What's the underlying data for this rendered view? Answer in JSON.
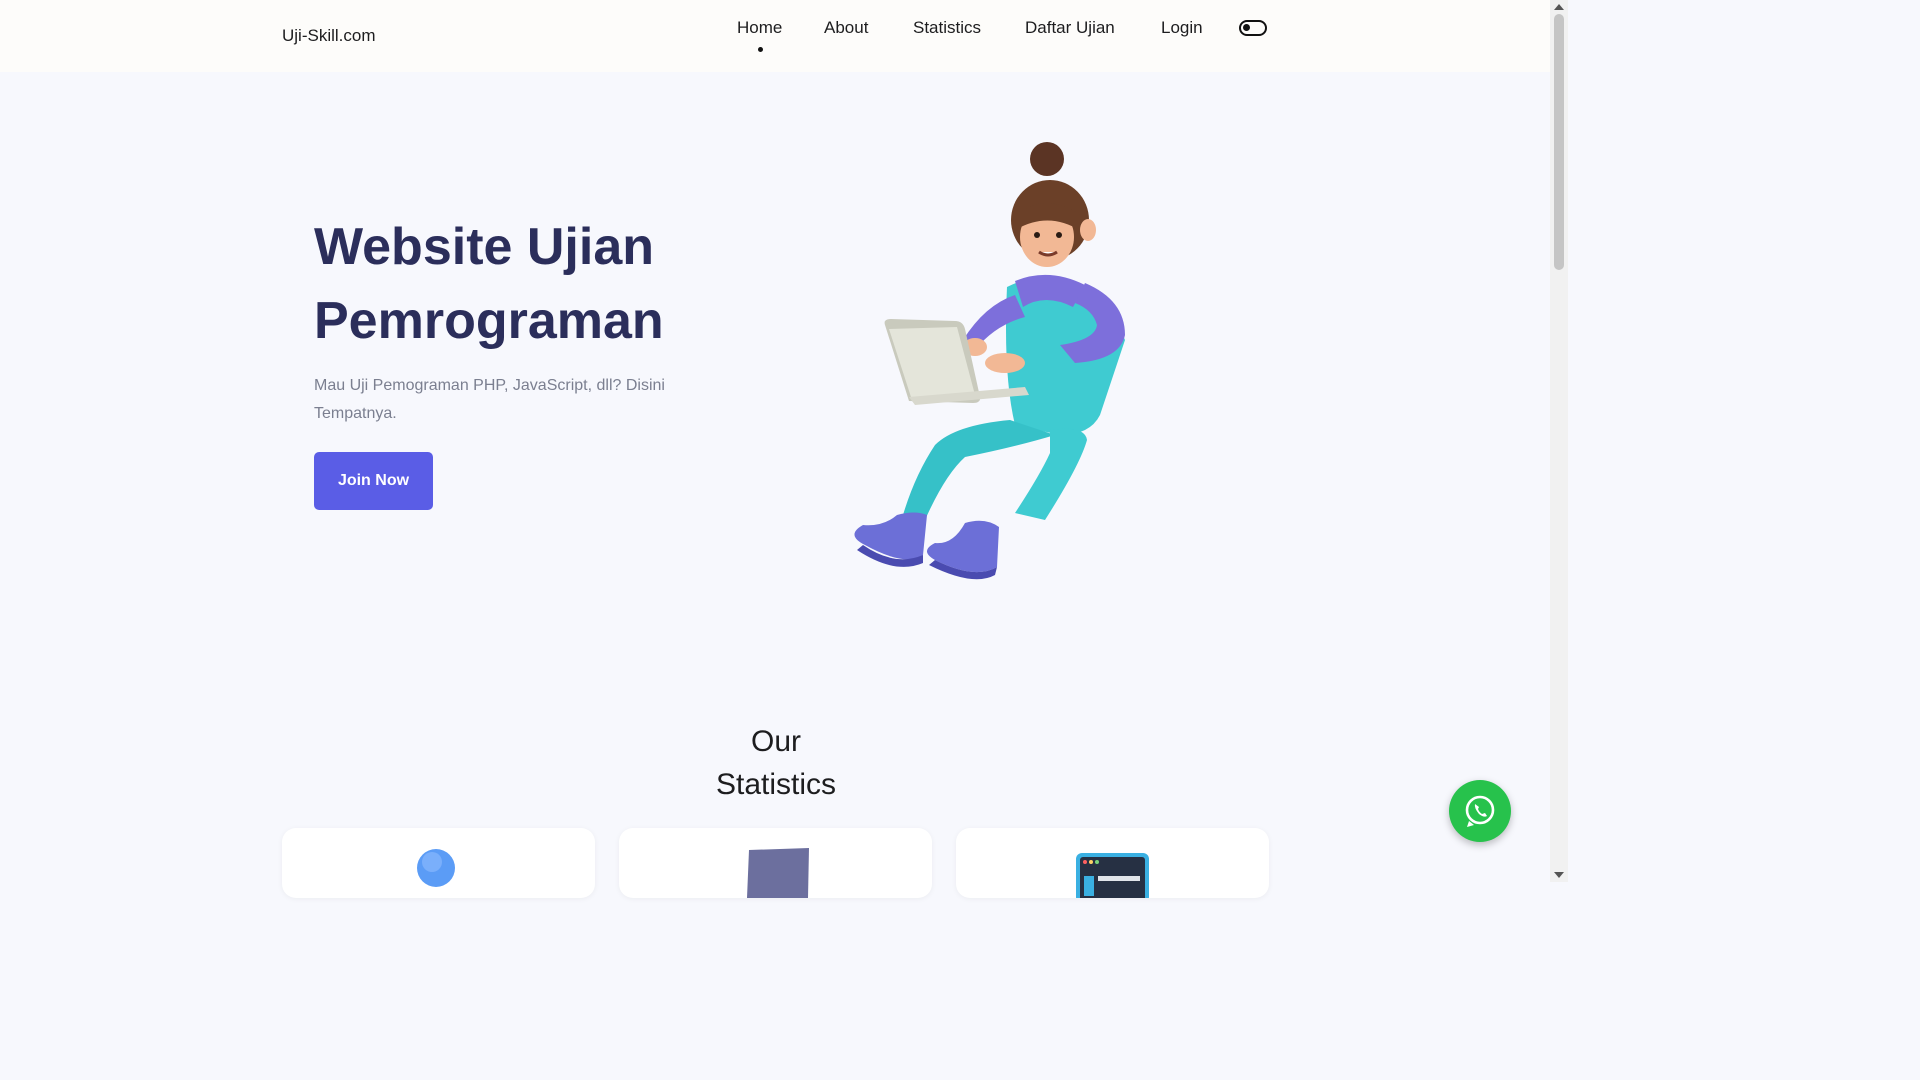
{
  "header": {
    "logo": "Uji-Skill.com",
    "nav": [
      {
        "label": "Home",
        "active": true
      },
      {
        "label": "About"
      },
      {
        "label": "Statistics"
      },
      {
        "label": "Daftar Ujian"
      },
      {
        "label": "Login"
      }
    ],
    "theme_toggle_icon": "toggle-icon"
  },
  "hero": {
    "title_line1": "Website Ujian",
    "title_line2": "Pemrograman",
    "subtitle": "Mau Uji Pemograman PHP, JavaScript, dll? Disini Tempatnya.",
    "cta_label": "Join Now",
    "illustration_icon": "person-with-laptop-illustration"
  },
  "stats": {
    "title_line1": "Our",
    "title_line2": "Statistics",
    "cards": [
      {
        "icon": "blue-sphere-icon"
      },
      {
        "icon": "laptop-icon"
      },
      {
        "icon": "browser-window-icon"
      }
    ]
  },
  "floating": {
    "whatsapp_icon": "whatsapp-icon"
  },
  "colors": {
    "accent": "#5a5de6",
    "heading": "#2b2e5b",
    "whatsapp": "#27c24c",
    "background": "#f7f8fd"
  }
}
